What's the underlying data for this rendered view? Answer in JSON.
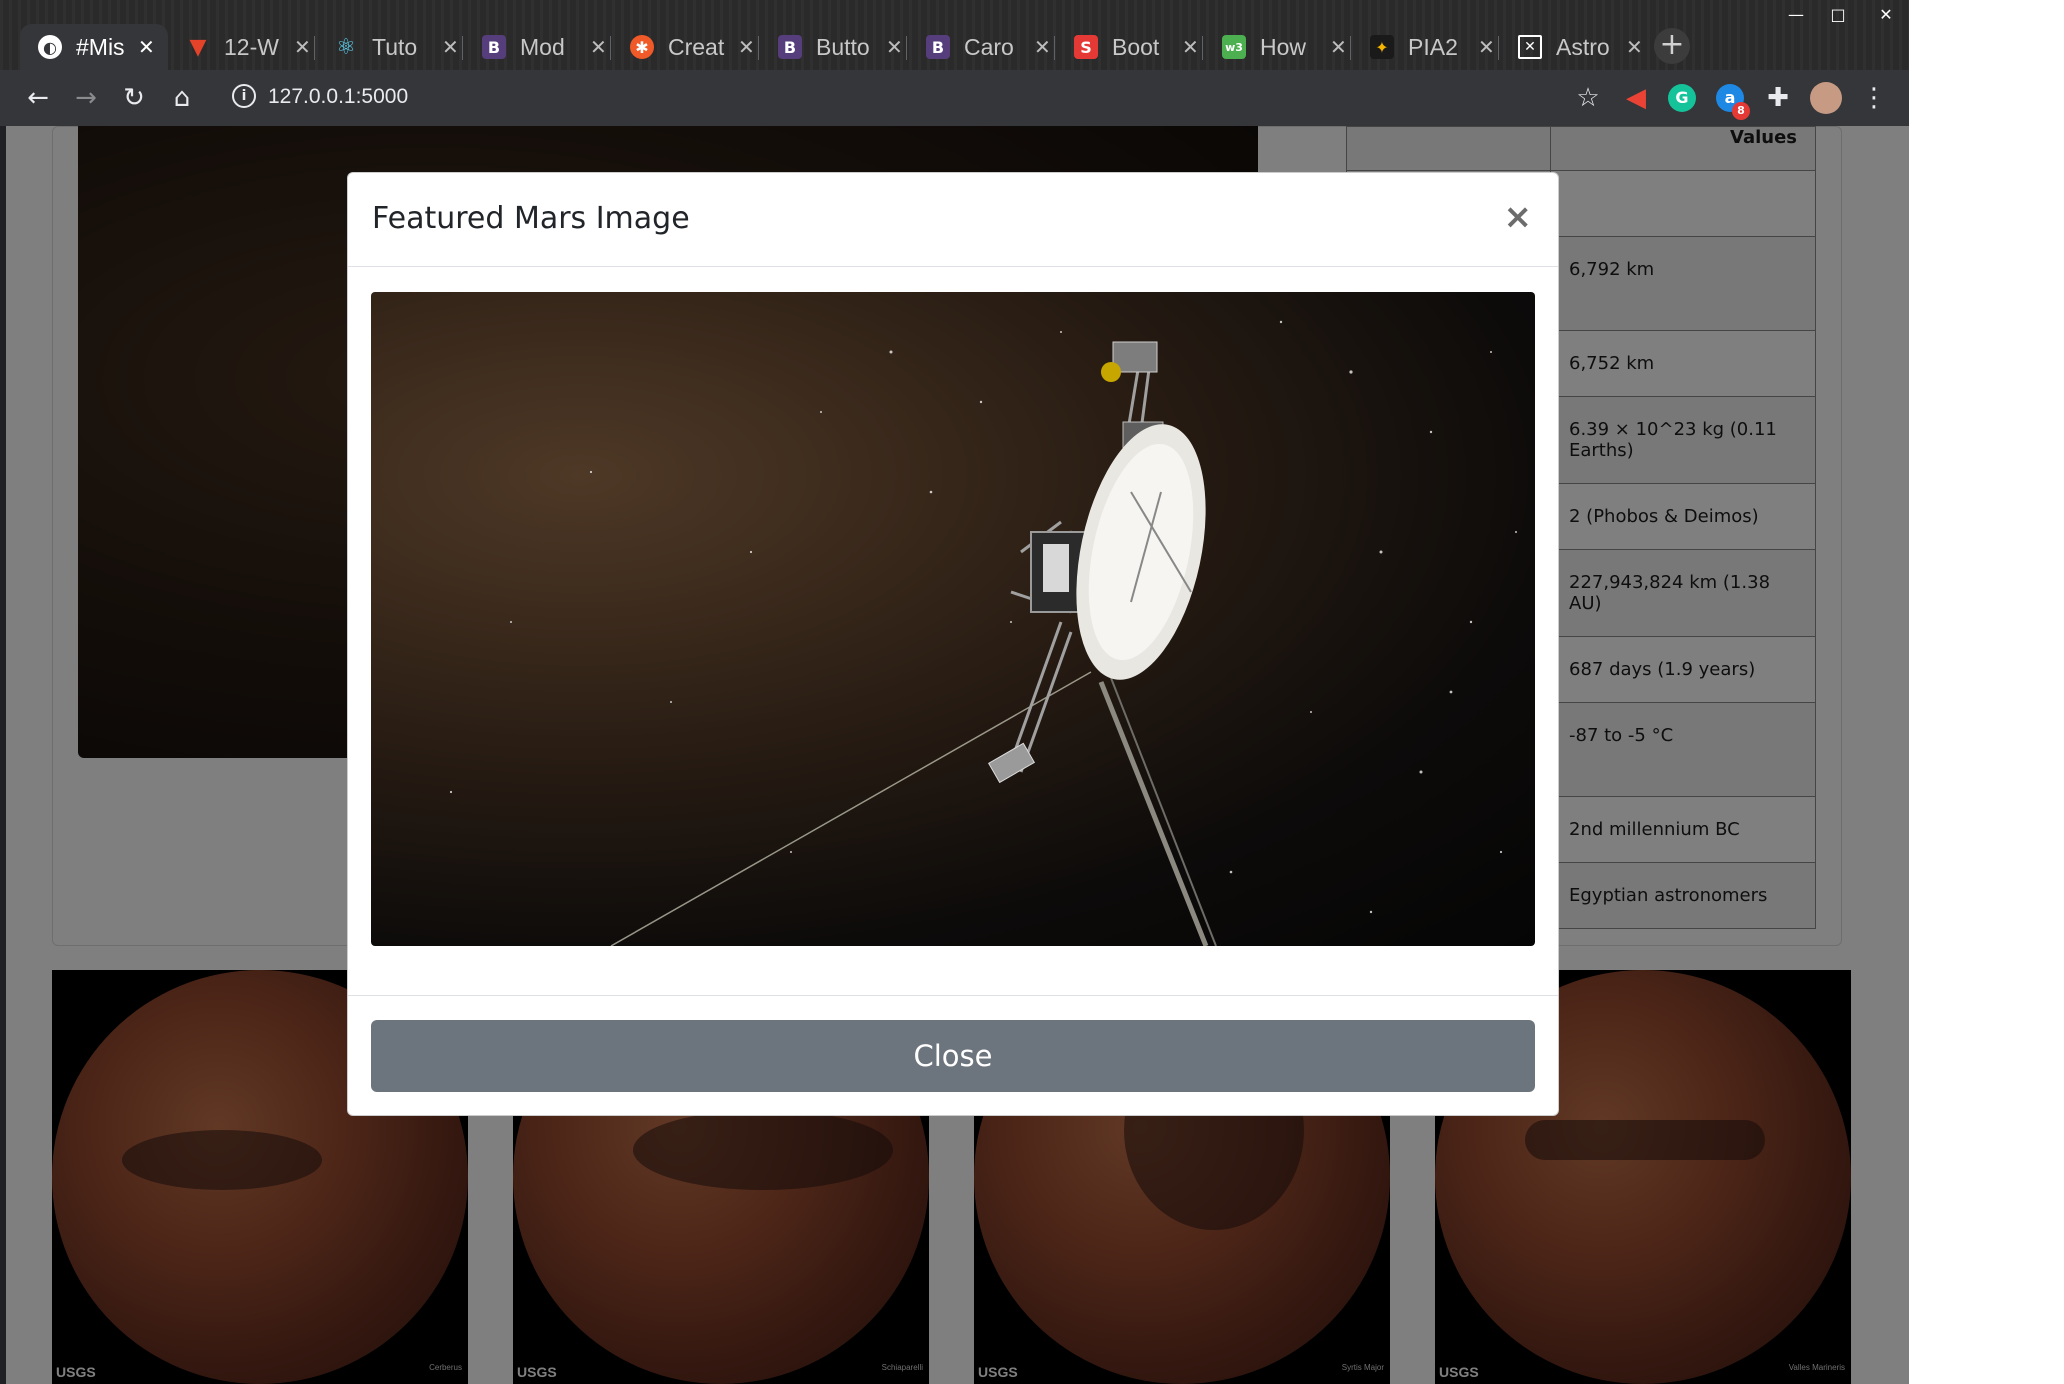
{
  "window": {
    "controls": {
      "minimize": "—",
      "maximize": "□",
      "close": "✕"
    }
  },
  "tabs": [
    {
      "label": "#Mis",
      "icon": "globe-icon",
      "color": "#ffffff",
      "active": true
    },
    {
      "label": "12-W",
      "icon": "gitlab-icon",
      "color": "#e24329"
    },
    {
      "label": "Tuto",
      "icon": "react-icon",
      "color": "#61dafb"
    },
    {
      "label": "Mod",
      "icon": "bootstrap-icon",
      "color": "#563d7c"
    },
    {
      "label": "Creat",
      "icon": "asterisk-icon",
      "color": "#f05a28"
    },
    {
      "label": "Butto",
      "icon": "bootstrap-icon",
      "color": "#563d7c"
    },
    {
      "label": "Caro",
      "icon": "bootstrap-icon",
      "color": "#563d7c"
    },
    {
      "label": "Boot",
      "icon": "s-icon",
      "color": "#e53935"
    },
    {
      "label": "How",
      "icon": "w3-icon",
      "color": "#4caf50"
    },
    {
      "label": "PIA2",
      "icon": "image-icon",
      "color": "#f4b400"
    },
    {
      "label": "Astro",
      "icon": "astro-icon",
      "color": "#ffffff"
    }
  ],
  "toolbar": {
    "url": "127.0.0.1:5000",
    "badge_count": "8"
  },
  "facts": {
    "header": "Values",
    "rows": [
      "",
      "6,792 km",
      "6,752 km",
      "6.39 × 10^23 kg (0.11 Earths)",
      "2 (Phobos & Deimos)",
      "227,943,824 km (1.38 AU)",
      "687 days (1.9 years)",
      "-87 to -5 °C",
      "2nd millennium BC",
      "Egyptian astronomers"
    ]
  },
  "hemispheres": [
    {
      "agency": "USGS",
      "name": "Cerberus"
    },
    {
      "agency": "USGS",
      "name": "Schiaparelli"
    },
    {
      "agency": "USGS",
      "name": "Syrtis Major"
    },
    {
      "agency": "USGS",
      "name": "Valles Marineris"
    }
  ],
  "modal": {
    "title": "Featured Mars Image",
    "close_x": "×",
    "close_label": "Close"
  }
}
